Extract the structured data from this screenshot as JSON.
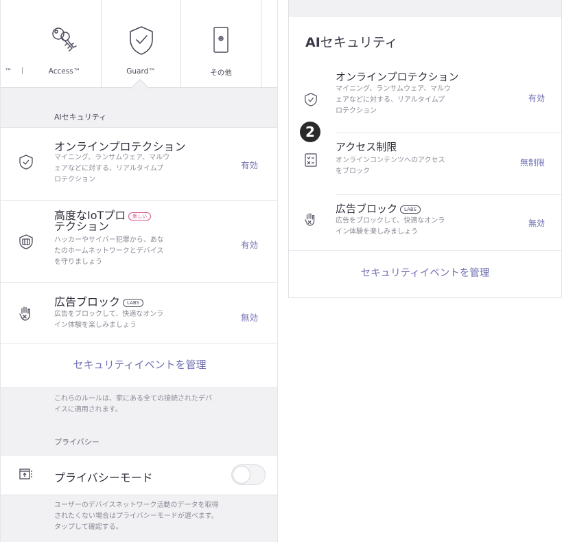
{
  "tabs": {
    "prev_label": "™",
    "access_label": "Access™",
    "guard_label": "Guard™",
    "other_label": "その他"
  },
  "left": {
    "section_title": "AIセキュリティ",
    "online": {
      "title_line1": "オンラインプロテクション",
      "desc": [
        "マイニング、ランサムウェア、マルウ",
        "ェアなどに対する、リアルタイムプ",
        "ロテクション"
      ],
      "value": "有効"
    },
    "iot": {
      "title_line1": "高度なIoTプロ",
      "badge": "新しい",
      "title_line2": "テクション",
      "desc": [
        "ハッカーやサイバー犯罪から、あな",
        "たのホームネットワークとデバイス",
        "を守りましょう"
      ],
      "value": "有効"
    },
    "adblock": {
      "title": "広告ブロック",
      "badge": "LABS",
      "desc": [
        "広告をブロックして、快適なオンラ",
        "イン体験を楽しみましょう"
      ],
      "value": "無効"
    },
    "manage_label": "セキュリティイベントを管理",
    "rules_note": [
      "これらのルールは、家にある全ての接続されたデバ",
      "イスに適用されます。"
    ],
    "privacy_section": "プライバシー",
    "privacy_mode": {
      "title": "プライバシーモード",
      "enabled": false
    },
    "privacy_note": [
      "ユーザーのデバイスネットワーク活動のデータを取得",
      "されたくない場合はプライバシーモードが選べます。",
      "タップして確認する。"
    ]
  },
  "right": {
    "title_bold": "AI",
    "title_rest": "セキュリティ",
    "step_number": "2",
    "online": {
      "title": "オンラインプロテクション",
      "desc": [
        "マイニング、ランサムウェア、マルウ",
        "ェアなどに対する、リアルタイムプ",
        "ロテクション"
      ],
      "value": "有効"
    },
    "access": {
      "title": "アクセス制限",
      "desc": [
        "オンラインコンテンツへのアクセス",
        "をブロック"
      ],
      "value": "無制限"
    },
    "adblock": {
      "title": "広告ブロック",
      "badge": "LABS",
      "desc": [
        "広告をブロックして、快適なオンラ",
        "イン体験を楽しみましょう"
      ],
      "value": "無効"
    },
    "manage_label": "セキュリティイベントを管理"
  },
  "colors": {
    "accent": "#6f6fb4",
    "new_badge": "#d9548a",
    "panel_gray": "#f1f1f4"
  },
  "icons": [
    "key-icon",
    "shield-check-icon",
    "router-icon",
    "lock-shield-icon",
    "shield-check-icon",
    "chip-shield-icon",
    "hand-block-icon",
    "checklist-icon",
    "privacy-box-icon"
  ]
}
